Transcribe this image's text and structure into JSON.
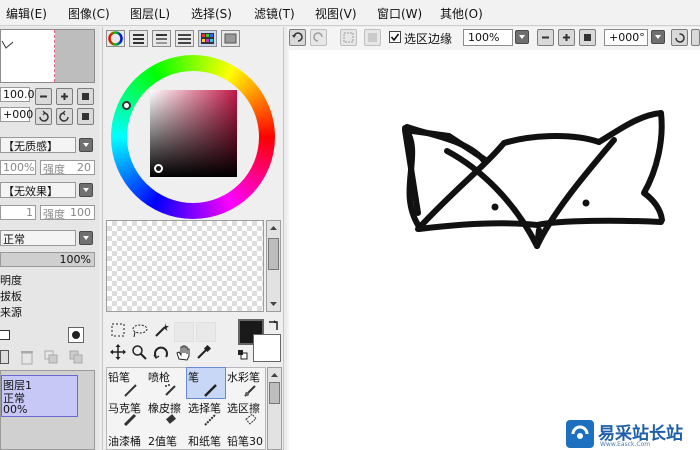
{
  "menu": [
    "编辑(E)",
    "图像(C)",
    "图层(L)",
    "选择(S)",
    "滤镜(T)",
    "视图(V)",
    "窗口(W)",
    "其他(O)"
  ],
  "navigator": {
    "zoom": "100.0%",
    "angle": "+000"
  },
  "brush_options": {
    "texture": "【无质感】",
    "texture_size": "100%",
    "texture_strength_label": "强度",
    "texture_strength_value": "20",
    "effect": "【无效果】",
    "effect_size": "1",
    "effect_strength_label": "强度",
    "effect_strength_value": "100"
  },
  "layer": {
    "blend_mode": "正常",
    "opacity": "100%",
    "options": [
      "明度",
      "拔板",
      "来源"
    ],
    "item": {
      "name": "图层1",
      "mode": "正常",
      "opacity": "00%"
    }
  },
  "toolbar": {
    "selection_edge_label": "选区边缘",
    "selection_edge_checked": true,
    "zoom": "100%",
    "angle": "+000°"
  },
  "tools": [
    [
      "铅笔",
      "喷枪",
      "笔",
      "水彩笔"
    ],
    [
      "马克笔",
      "橡皮擦",
      "选择笔",
      "选区擦"
    ],
    [
      "油漆桶",
      "2值笔",
      "和纸笔",
      "铅笔30"
    ]
  ],
  "colors": {
    "foreground": "#1a1a1a",
    "background": "#ffffff",
    "accent_selected": "#c8d7f5"
  },
  "watermark": {
    "title": "易采站长站",
    "sub": "Www.Easck.Com"
  }
}
